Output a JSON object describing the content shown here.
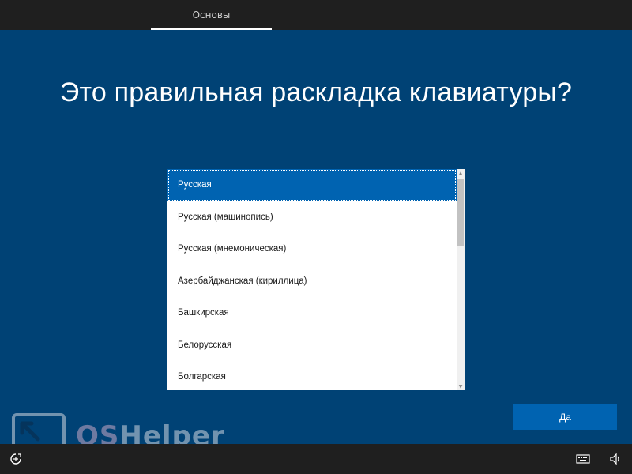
{
  "header": {
    "tab_label": "Основы"
  },
  "main": {
    "title": "Это правильная раскладка клавиатуры?",
    "layouts": [
      {
        "label": "Русская",
        "selected": true
      },
      {
        "label": "Русская (машинопись)",
        "selected": false
      },
      {
        "label": "Русская (мнемоническая)",
        "selected": false
      },
      {
        "label": "Азербайджанская (кириллица)",
        "selected": false
      },
      {
        "label": "Башкирская",
        "selected": false
      },
      {
        "label": "Белорусская",
        "selected": false
      },
      {
        "label": "Болгарская",
        "selected": false
      }
    ],
    "yes_button_label": "Да"
  },
  "footer": {
    "icons": [
      "ease-of-access-icon",
      "keyboard-icon",
      "volume-icon"
    ]
  },
  "watermark": {
    "text_os": "OS",
    "text_helper": " Helper"
  },
  "colors": {
    "background": "#004275",
    "accent": "#0063b1",
    "bars": "#1f1f1f"
  }
}
